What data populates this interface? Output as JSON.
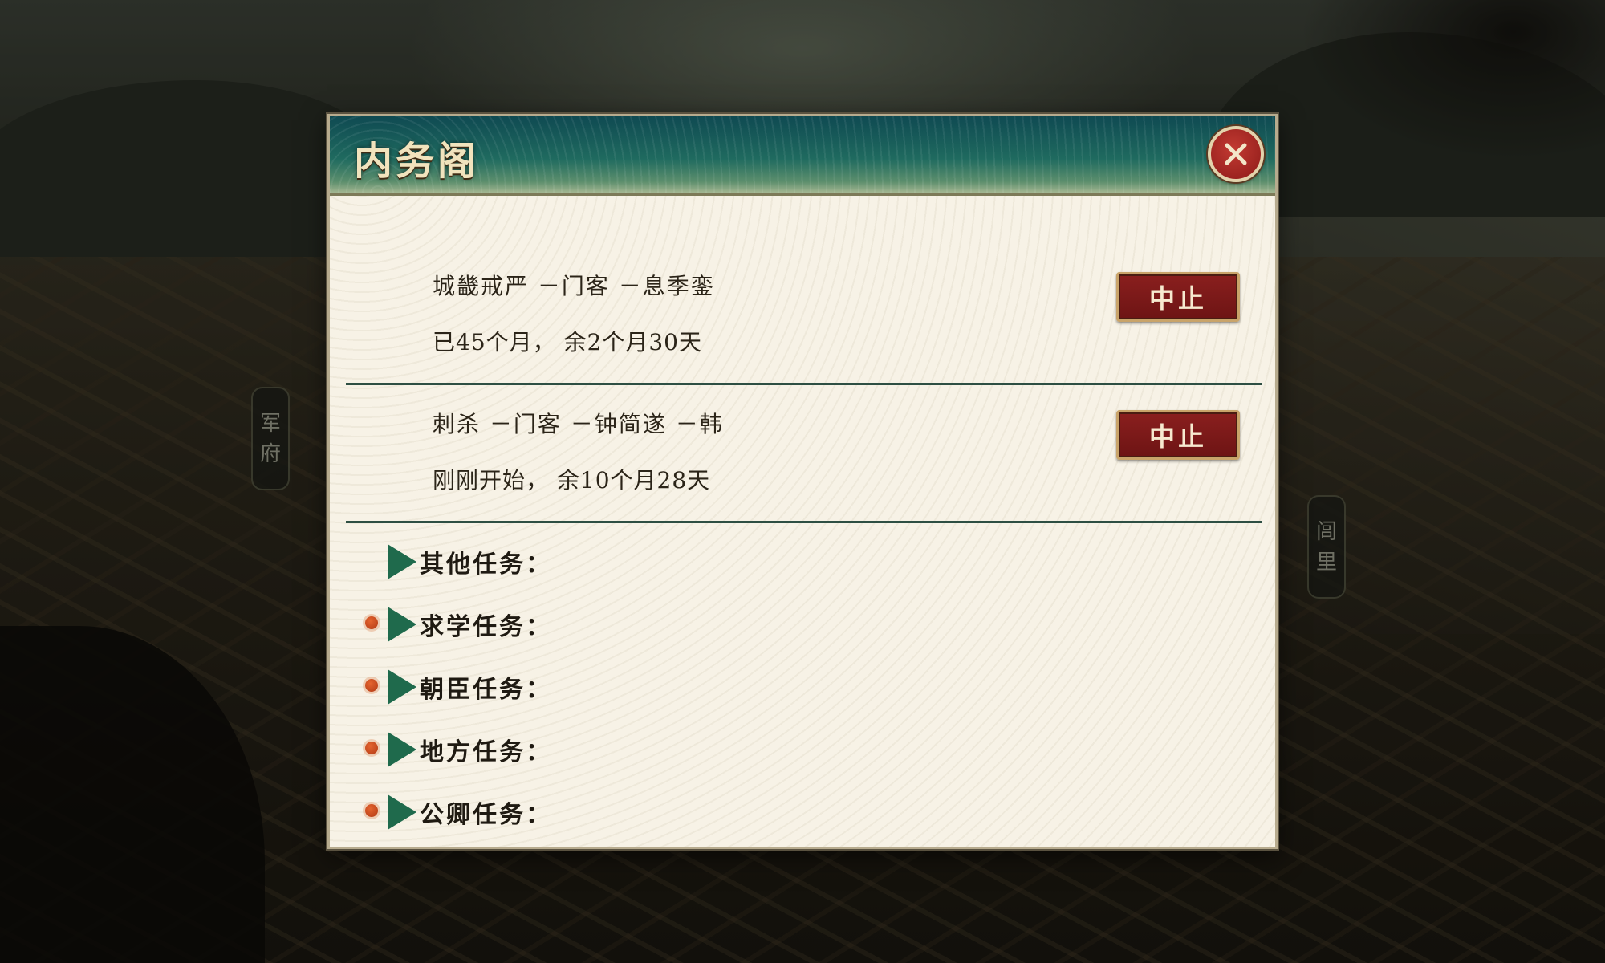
{
  "side_tags": {
    "left": [
      "军",
      "府"
    ],
    "right": [
      "闾",
      "里"
    ]
  },
  "dialog": {
    "title": "内务阁",
    "close_icon": "close-icon",
    "tasks": [
      {
        "name": "城畿戒严 －门客 －息季銮",
        "progress": "已45个月， 余2个月30天",
        "stop_label": "中止"
      },
      {
        "name": "刺杀 －门客 －钟简遂 －韩",
        "progress": "刚刚开始， 余10个月28天",
        "stop_label": "中止"
      }
    ],
    "categories": [
      {
        "label": "其他任务：",
        "has_dot": false
      },
      {
        "label": "求学任务：",
        "has_dot": true
      },
      {
        "label": "朝臣任务：",
        "has_dot": true
      },
      {
        "label": "地方任务：",
        "has_dot": true
      },
      {
        "label": "公卿任务：",
        "has_dot": true
      }
    ]
  },
  "colors": {
    "title_bar": "#1f6a5f",
    "stop_button": "#8a1f1e",
    "arrow": "#1f6a4c",
    "dot": "#d4532a",
    "panel_bg": "#f7f2e6"
  }
}
